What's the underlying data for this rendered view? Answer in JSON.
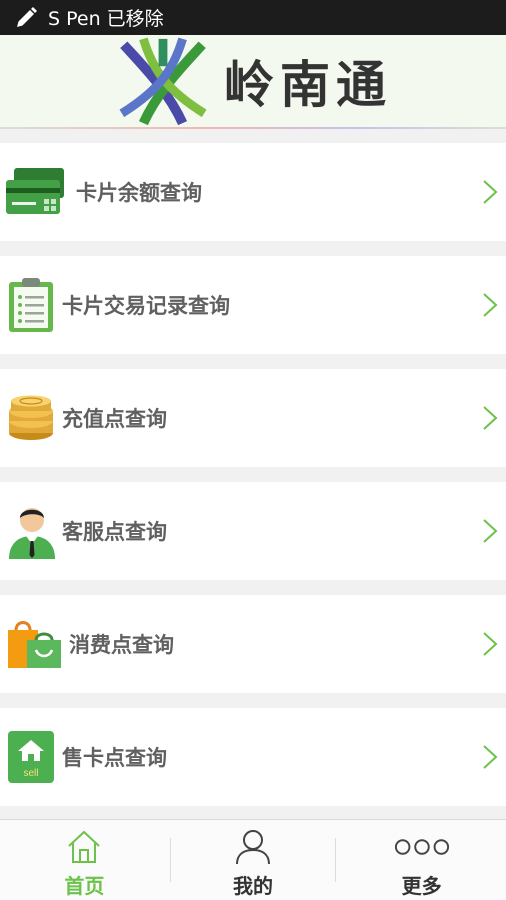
{
  "status_bar": {
    "notification": "S Pen 已移除"
  },
  "header": {
    "title": "岭南通"
  },
  "menu": [
    {
      "label": "卡片余额查询",
      "icon": "bank-card-icon"
    },
    {
      "label": "卡片交易记录查询",
      "icon": "clipboard-list-icon"
    },
    {
      "label": "充值点查询",
      "icon": "coins-icon"
    },
    {
      "label": "客服点查询",
      "icon": "agent-person-icon"
    },
    {
      "label": "消费点查询",
      "icon": "shopping-bag-icon"
    },
    {
      "label": "售卡点查询",
      "icon": "sell-house-icon"
    }
  ],
  "tabs": [
    {
      "label": "首页",
      "icon": "home-icon",
      "active": true
    },
    {
      "label": "我的",
      "icon": "user-icon",
      "active": false
    },
    {
      "label": "更多",
      "icon": "more-dots-icon",
      "active": false
    }
  ],
  "colors": {
    "accent_green": "#6cc24a",
    "status_bar": "#1c1c1c",
    "header_bg": "#f4f9ef"
  }
}
